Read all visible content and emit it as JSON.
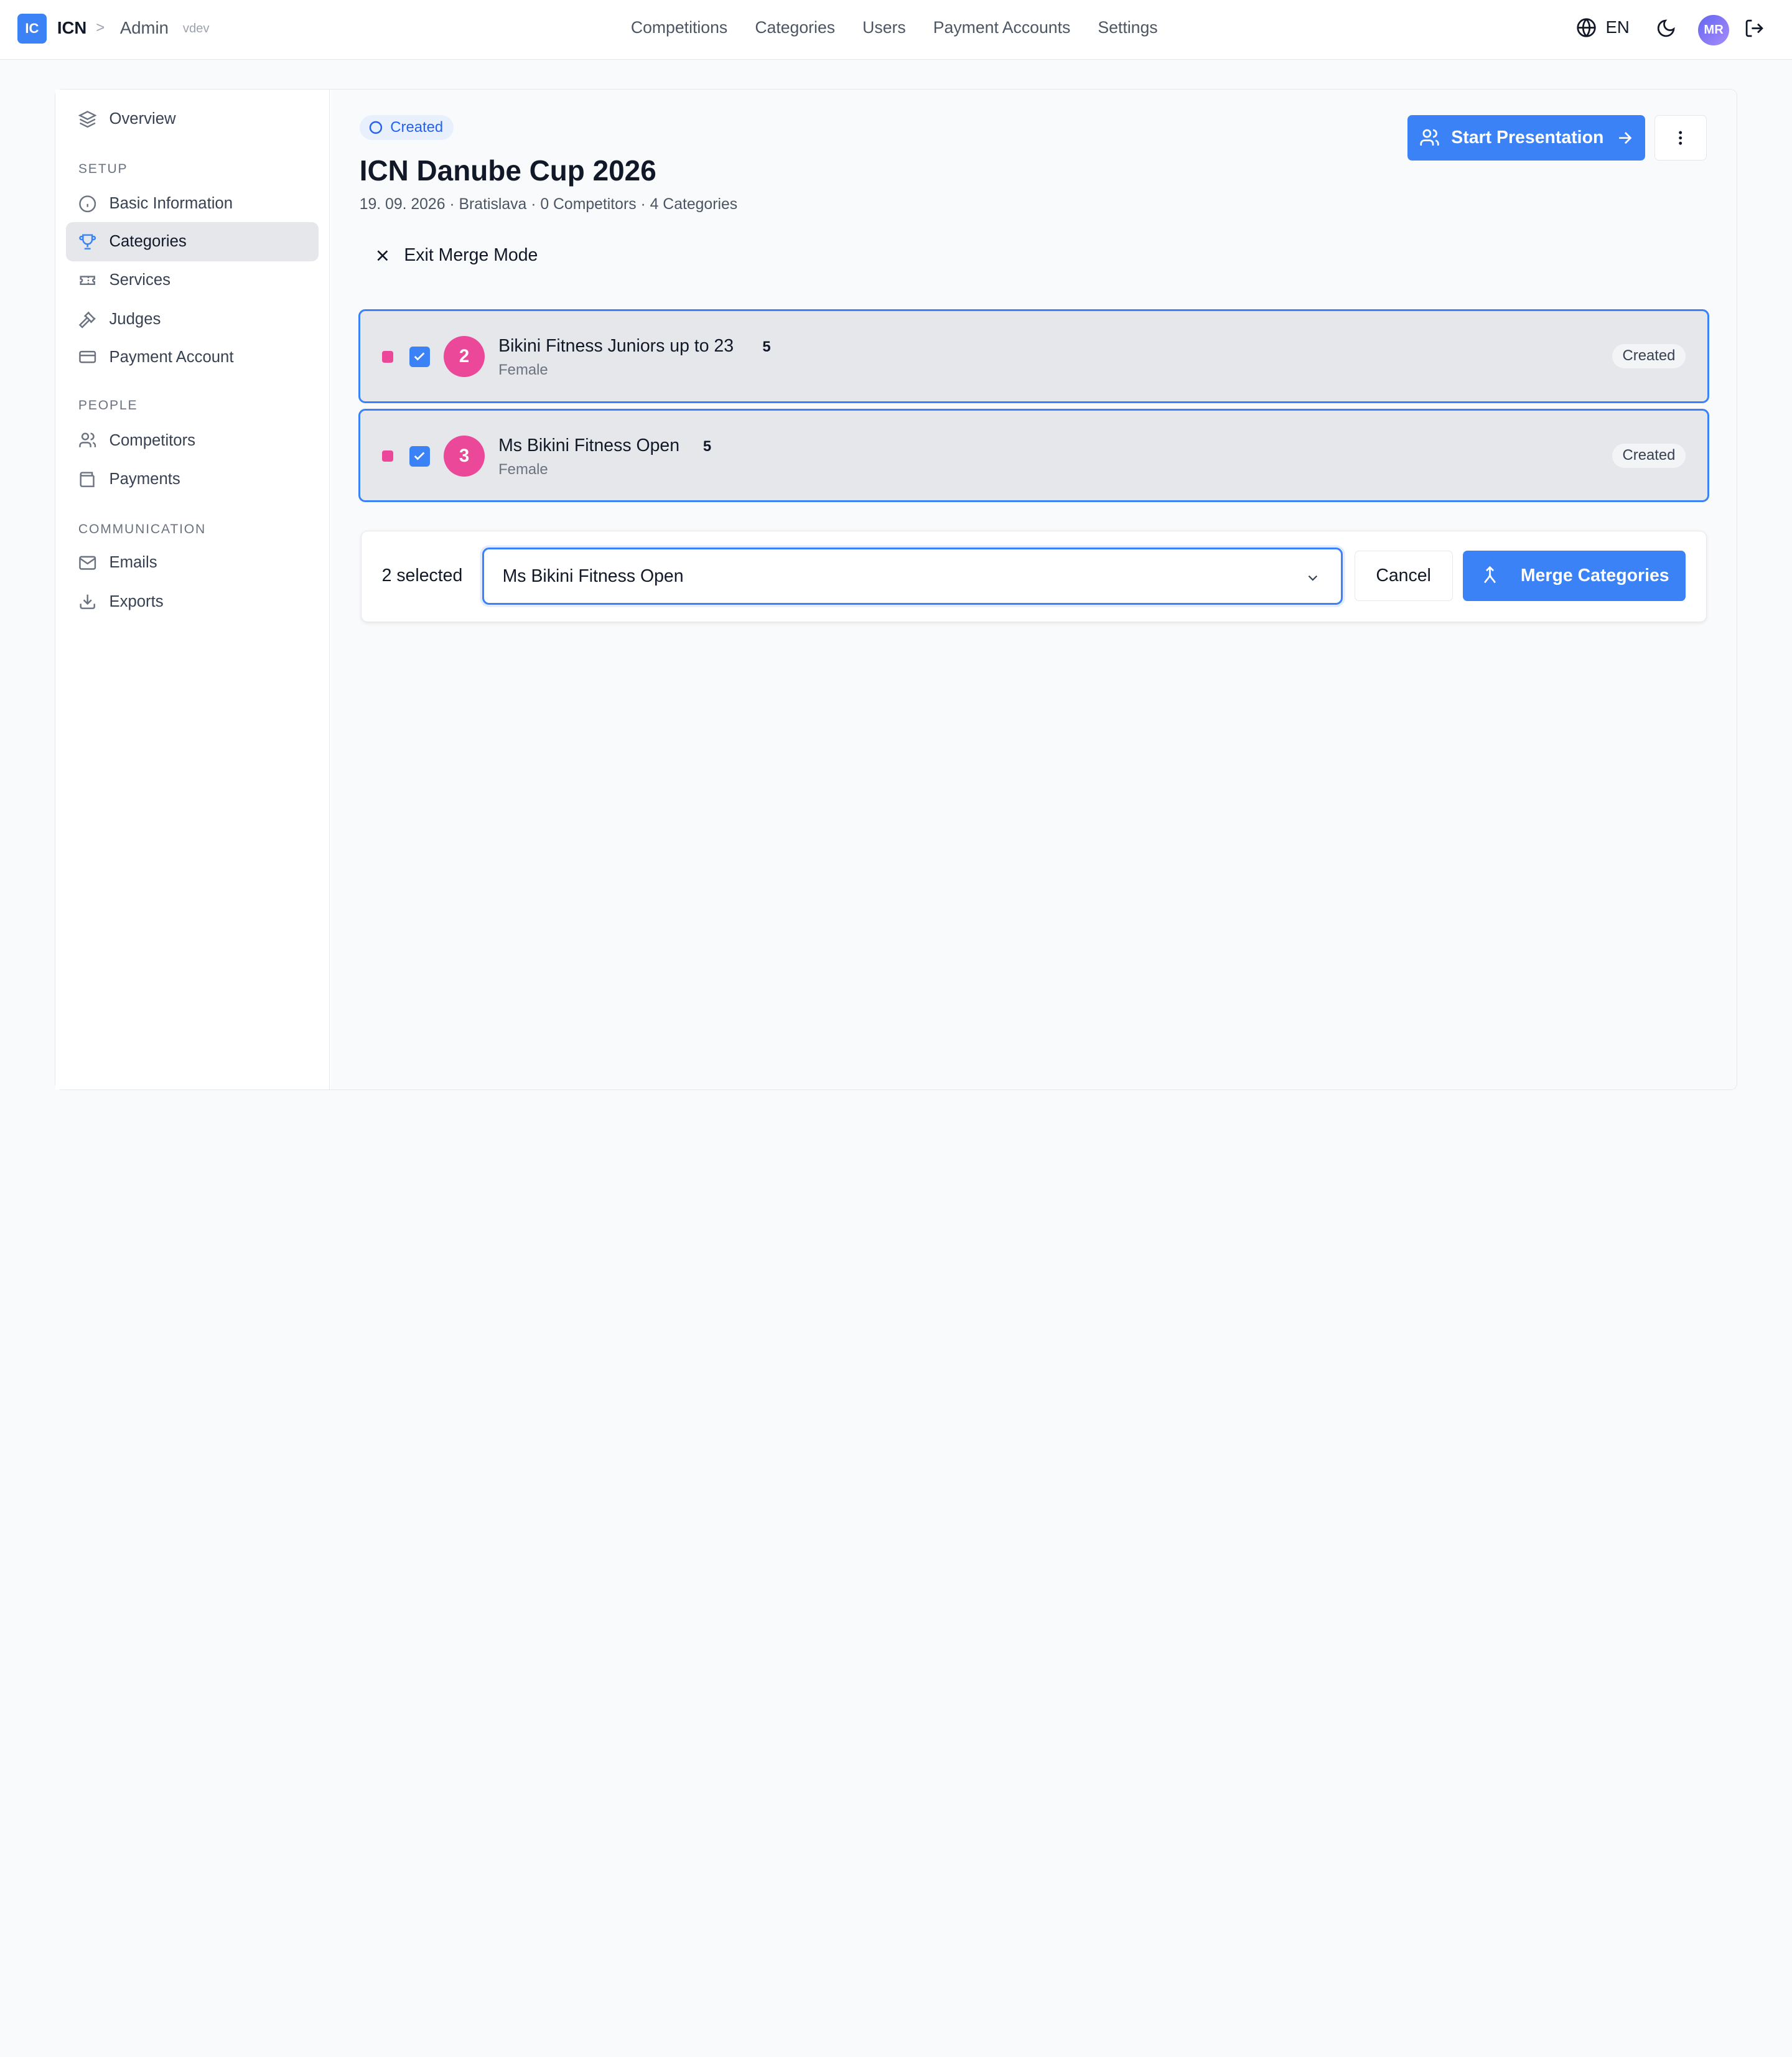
{
  "topbar": {
    "logo": "IC",
    "brand": "ICN",
    "crumb_sep": ">",
    "crumb": "Admin",
    "env": "vdev",
    "nav": [
      "Competitions",
      "Categories",
      "Users",
      "Payment Accounts",
      "Settings"
    ],
    "language": "EN",
    "avatar_initials": "MR"
  },
  "sidebar": {
    "overview": "Overview",
    "setup_heading": "SETUP",
    "setup_items": [
      "Basic Information",
      "Categories",
      "Services",
      "Judges",
      "Payment Account"
    ],
    "people_heading": "PEOPLE",
    "people_items": [
      "Competitors",
      "Payments"
    ],
    "communication_heading": "COMMUNICATION",
    "communication_items": [
      "Emails",
      "Exports"
    ],
    "active": "Categories"
  },
  "competition": {
    "status": "Created",
    "title": "ICN Danube Cup 2026",
    "meta": "19. 09. 2026 · Bratislava · 0 Competitors · 4 Categories",
    "start_presentation": "Start Presentation"
  },
  "merge_mode": {
    "exit_label": "Exit Merge Mode",
    "categories": [
      {
        "number": "2",
        "name": "Bikini Fitness Juniors up to 23",
        "count": "5",
        "gender": "Female",
        "status": "Created",
        "checked": true
      },
      {
        "number": "3",
        "name": "Ms Bikini Fitness Open",
        "count": "5",
        "gender": "Female",
        "status": "Created",
        "checked": true
      }
    ],
    "selected_count": "2 selected",
    "target_value": "Ms Bikini Fitness Open",
    "cancel_label": "Cancel",
    "merge_label": "Merge Categories"
  },
  "colors": {
    "accent": "#3b82f6",
    "category_marker": "#ec4899",
    "active_sidebar_bg": "#e5e7eb"
  }
}
